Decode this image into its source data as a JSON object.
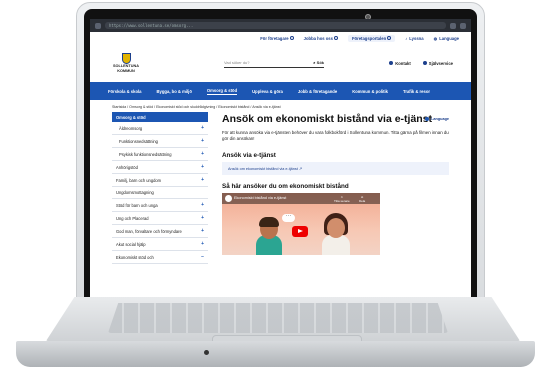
{
  "browser": {
    "url": "https://www.sollentuna.se/omsorg..."
  },
  "utility_bar": {
    "for_foretagare": "För företagare",
    "jobba_hos_oss": "Jobba hos oss",
    "foretagsportalen": "Företagsportalen",
    "lyssna": "Lyssna",
    "language": "Language"
  },
  "header": {
    "logo_text": "SOLLENTUNA KOMMUN",
    "search_placeholder": "Vad söker du?",
    "search_button": "Sök",
    "kontakt": "Kontakt",
    "sjalvservice": "Självservice"
  },
  "nav": {
    "items": [
      "Förskola & skola",
      "Bygga, bo & miljö",
      "Omsorg & stöd",
      "Uppleva & göra",
      "Jobb & företagande",
      "Kommun & politik",
      "Trafik & resor"
    ]
  },
  "breadcrumb": "Startsida / Omsorg & stöd / Ekonomiskt stöd och skuldrådgivning / Ekonomiskt bistånd / Ansök via e-tjänst",
  "sidebar": {
    "heading": "Omsorg & stöd",
    "items": [
      {
        "label": "Äldreomsorg",
        "plus": "+"
      },
      {
        "label": "Funktionsnedsättning",
        "plus": "+"
      },
      {
        "label": "Psykisk funktionsnedsättning",
        "plus": "+"
      },
      {
        "label": "Anhörigstöd",
        "plus": "+"
      },
      {
        "label": "Familj, barn och ungdom",
        "plus": "+"
      },
      {
        "label": "Ungdomsmottagning",
        "plus": ""
      },
      {
        "label": "Stöd för barn och unga",
        "plus": "+"
      },
      {
        "label": "Ung och Placerad",
        "plus": "+"
      },
      {
        "label": "God man, förvaltare och förmyndare",
        "plus": "+"
      },
      {
        "label": "Akut social hjälp",
        "plus": "+"
      },
      {
        "label": "Ekonomiskt stöd och",
        "plus": "−"
      }
    ]
  },
  "main": {
    "title": "Ansök om ekonomiskt bistånd via e-tjänst",
    "language_link": "Language",
    "lead": "För att kunna ansöka via e-tjänsten behöver du vara folkbokförd i Sollentuna kommun. Titta gärna på filmen innan du gör din ansökan!",
    "etjanst_heading": "Ansök via e-tjänst",
    "etjanst_link": "Ansök om ekonomiskt bistånd via e-tjänst",
    "video_heading": "Så här ansöker du om ekonomiskt bistånd",
    "video_title": "Ekonomiskt bistånd via e-tjänst",
    "video_watch_later": "Titta senare",
    "video_share": "Dela"
  },
  "colors": {
    "brand_blue": "#1c56b3",
    "link_blue": "#1c3f8c"
  }
}
